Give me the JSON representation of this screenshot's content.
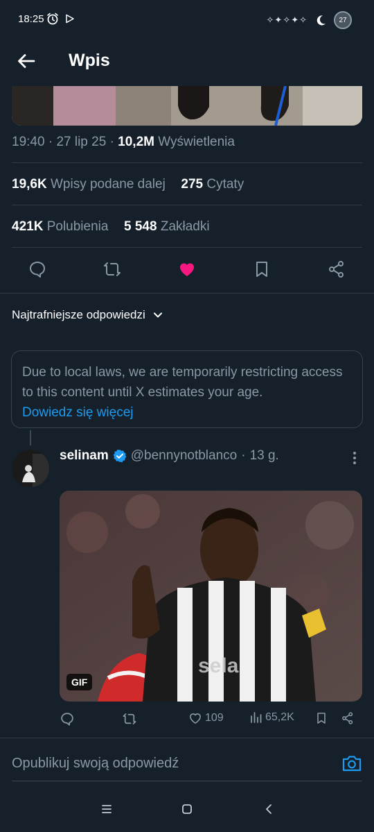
{
  "status_bar": {
    "time": "18:25",
    "left_icons": [
      "alarm-icon",
      "play-store-icon"
    ],
    "right_icons": [
      "sparkles-icon",
      "moon-icon"
    ],
    "badge": "27"
  },
  "header": {
    "title": "Wpis",
    "back_icon": "arrow-left-icon"
  },
  "post": {
    "time": "19:40",
    "date": "27 lip 25",
    "views_count": "10,2M",
    "views_label": "Wyświetlenia",
    "reposts_count": "19,6K",
    "reposts_label": "Wpisy podane dalej",
    "quotes_count": "275",
    "quotes_label": "Cytaty",
    "likes_count": "421K",
    "likes_label": "Polubienia",
    "bookmarks_count": "5 548",
    "bookmarks_label": "Zakładki",
    "actions": [
      "reply-icon",
      "repost-icon",
      "like-icon",
      "bookmark-icon",
      "share-icon"
    ],
    "liked": true,
    "like_color": "#f91880"
  },
  "replies": {
    "sort_label": "Najtrafniejsze odpowiedzi"
  },
  "notice": {
    "text": "Due to local laws, we are temporarily restricting access to this content until X estimates your age.",
    "link": "Dowiedz się więcej"
  },
  "reply_tweet": {
    "name": "selinam",
    "verified": true,
    "handle": "@bennynotblanco",
    "separator": "·",
    "age": "13 g.",
    "gif_badge": "GIF",
    "likes": "109",
    "views": "65,2K"
  },
  "compose": {
    "placeholder": "Opublikuj swoją odpowiedź"
  },
  "colors": {
    "background": "#15202b",
    "accent": "#1d9bf0",
    "muted": "#8b98a5",
    "like": "#f91880"
  }
}
